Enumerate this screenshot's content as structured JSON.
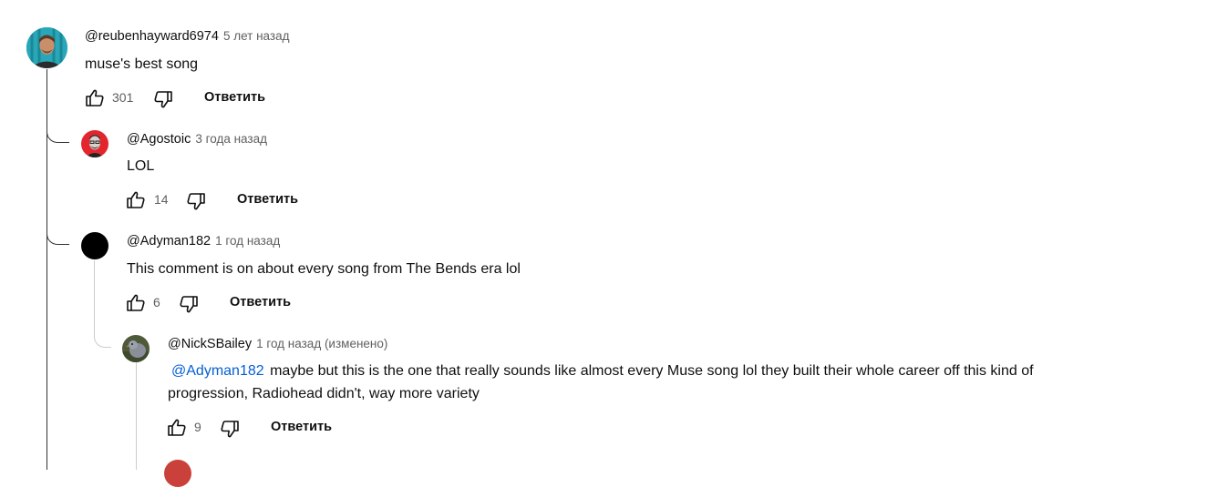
{
  "comments": [
    {
      "author": "@reubenhayward6974",
      "time": "5 лет назад",
      "text": "muse's best song",
      "likes": "301",
      "reply_label": "Ответить"
    },
    {
      "author": "@Agostoic",
      "time": "3 года назад",
      "text": "LOL",
      "likes": "14",
      "reply_label": "Ответить"
    },
    {
      "author": "@Adyman182",
      "time": "1 год назад",
      "text": "This comment is on about every song from The Bends era lol",
      "likes": "6",
      "reply_label": "Ответить"
    },
    {
      "author": "@NickSBailey",
      "time": "1 год назад (изменено)",
      "mention": "@Adyman182",
      "text": "maybe but this is the one that really sounds like almost every Muse song lol they built their whole career off this kind of progression, Radiohead didn't, way more variety",
      "likes": "9",
      "reply_label": "Ответить"
    }
  ],
  "icons": {
    "like": "thumb-up-icon",
    "dislike": "thumb-down-icon"
  },
  "colors": {
    "mention": "#065fd4",
    "meta": "#606060",
    "thread_line": "#cccccc"
  }
}
